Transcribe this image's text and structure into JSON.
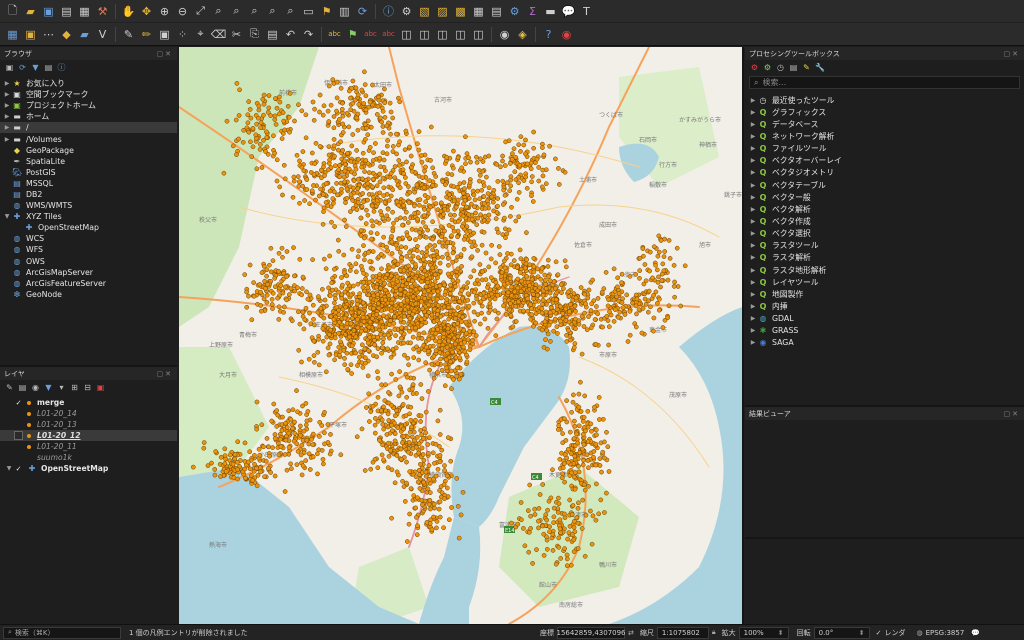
{
  "browser_panel": {
    "title": "ブラウザ",
    "items": [
      {
        "label": "お気に入り",
        "icon": "star-icon",
        "expand": true
      },
      {
        "label": "空間ブックマーク",
        "icon": "bookmark-icon",
        "expand": true
      },
      {
        "label": "プロジェクトホーム",
        "icon": "project-home-icon",
        "expand": true
      },
      {
        "label": "ホーム",
        "icon": "folder-icon",
        "expand": true
      },
      {
        "label": "/",
        "icon": "folder-icon",
        "expand": true,
        "selected": true
      },
      {
        "label": "/Volumes",
        "icon": "folder-icon",
        "expand": true
      },
      {
        "label": "GeoPackage",
        "icon": "geopackage-icon",
        "expand": false
      },
      {
        "label": "SpatiaLite",
        "icon": "spatialite-icon",
        "expand": false
      },
      {
        "label": "PostGIS",
        "icon": "postgis-icon",
        "expand": false
      },
      {
        "label": "MSSQL",
        "icon": "mssql-icon",
        "expand": false
      },
      {
        "label": "DB2",
        "icon": "db2-icon",
        "expand": false
      },
      {
        "label": "WMS/WMTS",
        "icon": "wms-icon",
        "expand": false
      },
      {
        "label": "XYZ Tiles",
        "icon": "xyz-tiles-icon",
        "expand": true,
        "expanded": true
      },
      {
        "label": "OpenStreetMap",
        "icon": "xyz-tiles-icon",
        "expand": false,
        "child": true
      },
      {
        "label": "WCS",
        "icon": "wcs-icon",
        "expand": false
      },
      {
        "label": "WFS",
        "icon": "wfs-icon",
        "expand": false
      },
      {
        "label": "OWS",
        "icon": "ows-icon",
        "expand": false
      },
      {
        "label": "ArcGisMapServer",
        "icon": "arcgis-icon",
        "expand": false
      },
      {
        "label": "ArcGisFeatureServer",
        "icon": "arcgis-icon",
        "expand": false
      },
      {
        "label": "GeoNode",
        "icon": "geonode-icon",
        "expand": false
      }
    ]
  },
  "layers_panel": {
    "title": "レイヤ",
    "layers": [
      {
        "label": "merge",
        "checked": true,
        "style": "bold",
        "point": true
      },
      {
        "label": "L01-20_14",
        "checked": false,
        "style": "italic",
        "point": true
      },
      {
        "label": "L01-20_13",
        "checked": false,
        "style": "italic",
        "point": true
      },
      {
        "label": "L01-20_12",
        "checked": false,
        "style": "bolditalic-selected",
        "point": true
      },
      {
        "label": "L01-20_11",
        "checked": false,
        "style": "italic",
        "point": true
      },
      {
        "label": "suumo1k",
        "checked": false,
        "style": "italic",
        "point": false
      },
      {
        "label": "OpenStreetMap",
        "checked": true,
        "style": "bold",
        "point": false,
        "tiles": true
      }
    ]
  },
  "toolbox_panel": {
    "title": "プロセシングツールボックス",
    "search_placeholder": "検索...",
    "items": [
      {
        "label": "最近使ったツール",
        "icon": "clock-icon"
      },
      {
        "label": "グラフィックス",
        "icon": "qgis-algorithm-icon"
      },
      {
        "label": "データベース",
        "icon": "qgis-algorithm-icon"
      },
      {
        "label": "ネットワーク解析",
        "icon": "qgis-algorithm-icon"
      },
      {
        "label": "ファイルツール",
        "icon": "qgis-algorithm-icon"
      },
      {
        "label": "ベクタオーバーレイ",
        "icon": "qgis-algorithm-icon"
      },
      {
        "label": "ベクタジオメトリ",
        "icon": "qgis-algorithm-icon"
      },
      {
        "label": "ベクタテーブル",
        "icon": "qgis-algorithm-icon"
      },
      {
        "label": "ベクター般",
        "icon": "qgis-algorithm-icon"
      },
      {
        "label": "ベクタ解析",
        "icon": "qgis-algorithm-icon"
      },
      {
        "label": "ベクタ作成",
        "icon": "qgis-algorithm-icon"
      },
      {
        "label": "ベクタ選択",
        "icon": "qgis-algorithm-icon"
      },
      {
        "label": "ラスタツール",
        "icon": "qgis-algorithm-icon"
      },
      {
        "label": "ラスタ解析",
        "icon": "qgis-algorithm-icon"
      },
      {
        "label": "ラスタ地形解析",
        "icon": "qgis-algorithm-icon"
      },
      {
        "label": "レイヤツール",
        "icon": "qgis-algorithm-icon"
      },
      {
        "label": "地図製作",
        "icon": "qgis-algorithm-icon"
      },
      {
        "label": "内挿",
        "icon": "qgis-algorithm-icon"
      },
      {
        "label": "GDAL",
        "icon": "gdal-icon"
      },
      {
        "label": "GRASS",
        "icon": "grass-icon"
      },
      {
        "label": "SAGA",
        "icon": "saga-icon"
      }
    ]
  },
  "results_panel": {
    "title": "結果ビューア"
  },
  "status_bar": {
    "search_placeholder": "検索（⌘K）",
    "message": "1 個の凡例エントリが削除されました",
    "coord_label": "座標",
    "coord_value": "15642859,4307096",
    "scale_label": "縮尺",
    "scale_value": "1:1075802",
    "magnifier_label": "拡大",
    "magnifier_value": "100%",
    "rotation_label": "回転",
    "rotation_value": "0.0°",
    "render_label": "レンダ",
    "crs_label": "EPSG:3857"
  },
  "map": {
    "point_color": "#e8940f",
    "point_outline": "#6b3d00",
    "land_color": "#f2efe9",
    "water_color": "#aad3df",
    "forest_color": "#cde6b9",
    "town_labels": [
      "前橋市",
      "伊勢崎市",
      "太田市",
      "古河市",
      "つくば市",
      "石岡市",
      "土浦市",
      "稲敷市",
      "成田市",
      "佐倉市",
      "八街市",
      "千葉市",
      "市原市",
      "木更津市",
      "君津市",
      "館山市",
      "横浜市",
      "横須賀市",
      "平塚市",
      "小田原市",
      "相模原市",
      "八王子市",
      "青梅市",
      "秩父市",
      "上野原市",
      "大月市",
      "鴨川市",
      "茂原市",
      "東金市",
      "旭市",
      "銚子市",
      "かすみがうら市",
      "行方市",
      "神栖市",
      "熱海市",
      "富津市",
      "南房総市"
    ],
    "road_labels": [
      "C4",
      "C4",
      "E14"
    ]
  }
}
